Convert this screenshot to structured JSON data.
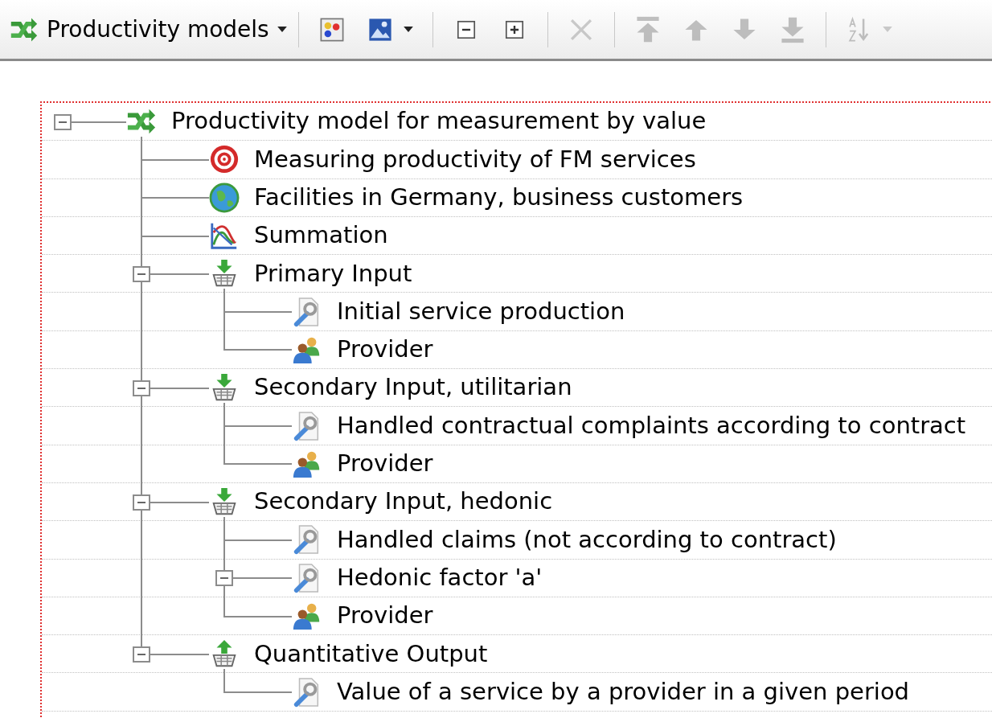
{
  "toolbar": {
    "model_menu": {
      "label": "Productivity models",
      "has_dropdown": true
    },
    "groups": [
      [
        {
          "kind": "palette",
          "disabled": false,
          "has_dropdown": false
        },
        {
          "kind": "picture",
          "disabled": false,
          "has_dropdown": true
        }
      ],
      [
        {
          "kind": "collapse_all",
          "disabled": false,
          "has_dropdown": false
        },
        {
          "kind": "expand_all",
          "disabled": false,
          "has_dropdown": false
        }
      ],
      [
        {
          "kind": "delete",
          "disabled": true,
          "has_dropdown": false
        }
      ],
      [
        {
          "kind": "move_top",
          "disabled": true,
          "has_dropdown": false
        },
        {
          "kind": "move_up",
          "disabled": true,
          "has_dropdown": false
        },
        {
          "kind": "move_down",
          "disabled": true,
          "has_dropdown": false
        },
        {
          "kind": "move_bottom",
          "disabled": true,
          "has_dropdown": false
        }
      ],
      [
        {
          "kind": "sort",
          "disabled": true,
          "has_dropdown": true
        }
      ]
    ]
  },
  "tree": {
    "label": "Productivity model for measurement by value",
    "kind": "model",
    "expanded": true,
    "children": [
      {
        "label": "Measuring productivity of FM services",
        "kind": "goal"
      },
      {
        "label": "Facilities in Germany, business customers",
        "kind": "scope"
      },
      {
        "label": "Summation",
        "kind": "aggregation"
      },
      {
        "label": "Primary Input",
        "kind": "input",
        "expanded": true,
        "children": [
          {
            "label": "Initial service production",
            "kind": "measure"
          },
          {
            "label": "Provider",
            "kind": "actor"
          }
        ]
      },
      {
        "label": "Secondary Input, utilitarian",
        "kind": "input",
        "expanded": true,
        "children": [
          {
            "label": "Handled contractual complaints according to contract",
            "kind": "measure"
          },
          {
            "label": "Provider",
            "kind": "actor"
          }
        ]
      },
      {
        "label": "Secondary Input, hedonic",
        "kind": "input",
        "expanded": true,
        "children": [
          {
            "label": "Handled claims (not according to contract)",
            "kind": "measure"
          },
          {
            "label": "Hedonic factor 'a'",
            "kind": "measure",
            "expanded": true
          },
          {
            "label": "Provider",
            "kind": "actor"
          }
        ]
      },
      {
        "label": "Quantitative Output",
        "kind": "output",
        "expanded": true,
        "children": [
          {
            "label": "Value of a service by a provider in a given period",
            "kind": "measure"
          }
        ]
      }
    ]
  }
}
